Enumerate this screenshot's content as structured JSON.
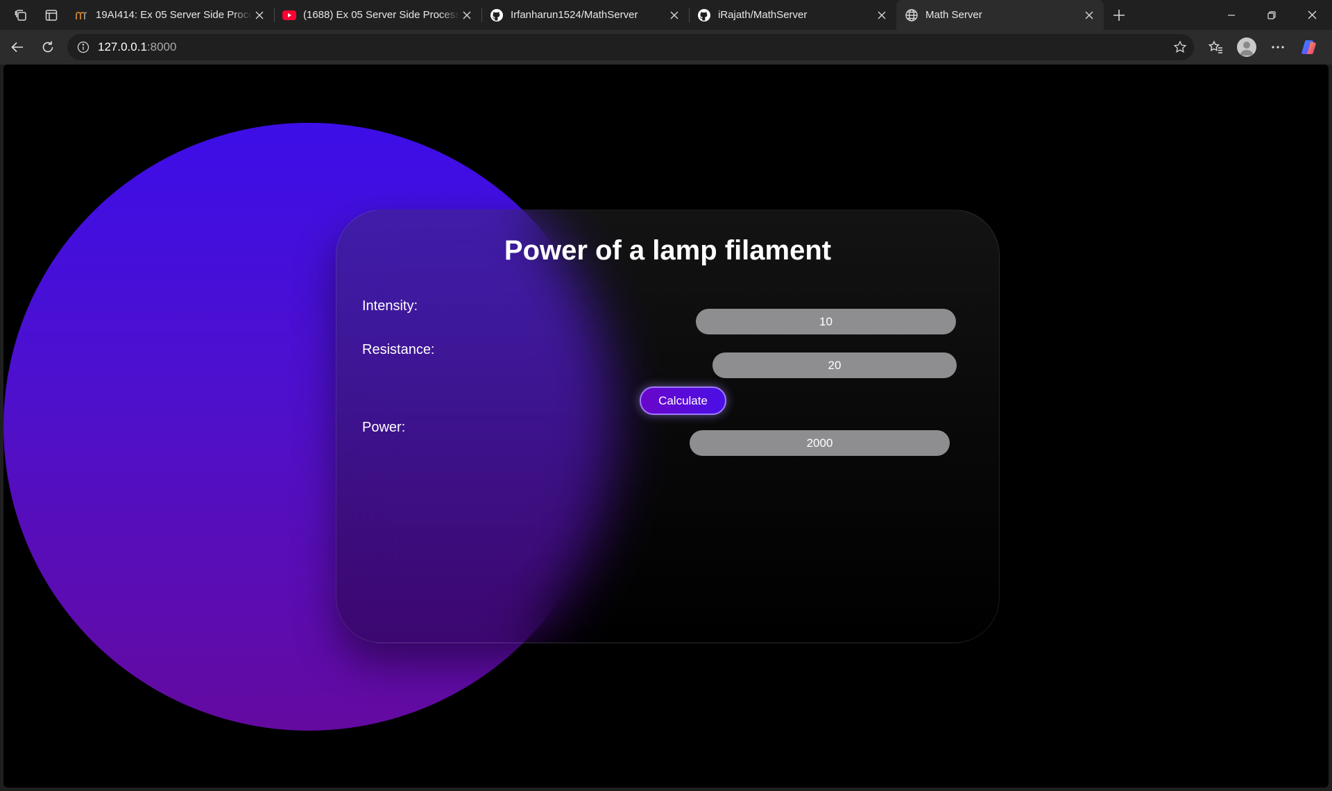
{
  "browser": {
    "tabs": [
      {
        "title": "19AI414: Ex 05 Server Side Processing",
        "favicon": "moodle-icon",
        "active": false
      },
      {
        "title": "(1688) Ex 05 Server Side Processing",
        "favicon": "youtube-icon",
        "active": false
      },
      {
        "title": "Irfanharun1524/MathServer",
        "favicon": "github-icon",
        "active": false
      },
      {
        "title": "iRajath/MathServer",
        "favicon": "github-icon",
        "active": false
      },
      {
        "title": "Math Server",
        "favicon": "globe-icon",
        "active": true
      }
    ],
    "address": {
      "host": "127.0.0.1",
      "port": ":8000"
    },
    "colors": {
      "tabstrip": "#202020",
      "toolbar": "#2c2c2c",
      "youtube": "#ff0033"
    }
  },
  "page": {
    "title": "Power of a lamp filament",
    "intensity": {
      "label": "Intensity:",
      "value": "10"
    },
    "resistance": {
      "label": "Resistance:",
      "value": "20"
    },
    "calculate_label": "Calculate",
    "power": {
      "label": "Power:",
      "value": "2000"
    },
    "colors": {
      "circle_top": "#3d0ee8",
      "circle_bottom": "#640aa0",
      "pill": "#8e8e90",
      "button": "#5a0bd8"
    }
  }
}
